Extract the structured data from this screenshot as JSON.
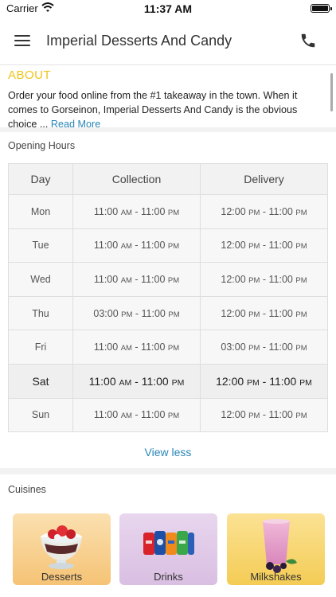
{
  "status_bar": {
    "carrier": "Carrier",
    "time": "11:37 AM"
  },
  "header": {
    "title": "Imperial Desserts And Candy",
    "menu_icon": "hamburger-menu-icon",
    "call_icon": "phone-icon"
  },
  "about": {
    "heading": "ABOUT",
    "text": "Order your food online from the #1 takeaway in the town. When it comes to Gorseinon, Imperial Desserts And Candy is the obvious choice",
    "ellipsis": " ... ",
    "read_more": "Read More"
  },
  "opening_hours": {
    "heading": "Opening Hours",
    "columns": [
      "Day",
      "Collection",
      "Delivery"
    ],
    "rows": [
      {
        "day": "Mon",
        "collection": {
          "from": "11:00",
          "from_ap": "AM",
          "to": "11:00",
          "to_ap": "PM"
        },
        "delivery": {
          "from": "12:00",
          "from_ap": "PM",
          "to": "11:00",
          "to_ap": "PM"
        }
      },
      {
        "day": "Tue",
        "collection": {
          "from": "11:00",
          "from_ap": "AM",
          "to": "11:00",
          "to_ap": "PM"
        },
        "delivery": {
          "from": "12:00",
          "from_ap": "PM",
          "to": "11:00",
          "to_ap": "PM"
        }
      },
      {
        "day": "Wed",
        "collection": {
          "from": "11:00",
          "from_ap": "AM",
          "to": "11:00",
          "to_ap": "PM"
        },
        "delivery": {
          "from": "12:00",
          "from_ap": "PM",
          "to": "11:00",
          "to_ap": "PM"
        }
      },
      {
        "day": "Thu",
        "collection": {
          "from": "03:00",
          "from_ap": "PM",
          "to": "11:00",
          "to_ap": "PM"
        },
        "delivery": {
          "from": "12:00",
          "from_ap": "PM",
          "to": "11:00",
          "to_ap": "PM"
        }
      },
      {
        "day": "Fri",
        "collection": {
          "from": "11:00",
          "from_ap": "AM",
          "to": "11:00",
          "to_ap": "PM"
        },
        "delivery": {
          "from": "03:00",
          "from_ap": "PM",
          "to": "11:00",
          "to_ap": "PM"
        }
      },
      {
        "day": "Sat",
        "collection": {
          "from": "11:00",
          "from_ap": "AM",
          "to": "11:00",
          "to_ap": "PM"
        },
        "delivery": {
          "from": "12:00",
          "from_ap": "PM",
          "to": "11:00",
          "to_ap": "PM"
        }
      },
      {
        "day": "Sun",
        "collection": {
          "from": "11:00",
          "from_ap": "AM",
          "to": "11:00",
          "to_ap": "PM"
        },
        "delivery": {
          "from": "12:00",
          "from_ap": "PM",
          "to": "11:00",
          "to_ap": "PM"
        }
      }
    ],
    "highlighted_day": "Sat",
    "view_less": "View less"
  },
  "cuisines": {
    "heading": "Cuisines",
    "items": [
      {
        "label": "Desserts",
        "color": "#f7cf8f",
        "icon": "dessert-bowl-icon"
      },
      {
        "label": "Drinks",
        "color": "#e2cbe8",
        "icon": "soda-cans-icon"
      },
      {
        "label": "Milkshakes",
        "color": "#f7d777",
        "icon": "milkshake-glass-icon"
      }
    ]
  },
  "colors": {
    "accent_yellow": "#f0c418",
    "link_blue": "#2a86b8"
  }
}
